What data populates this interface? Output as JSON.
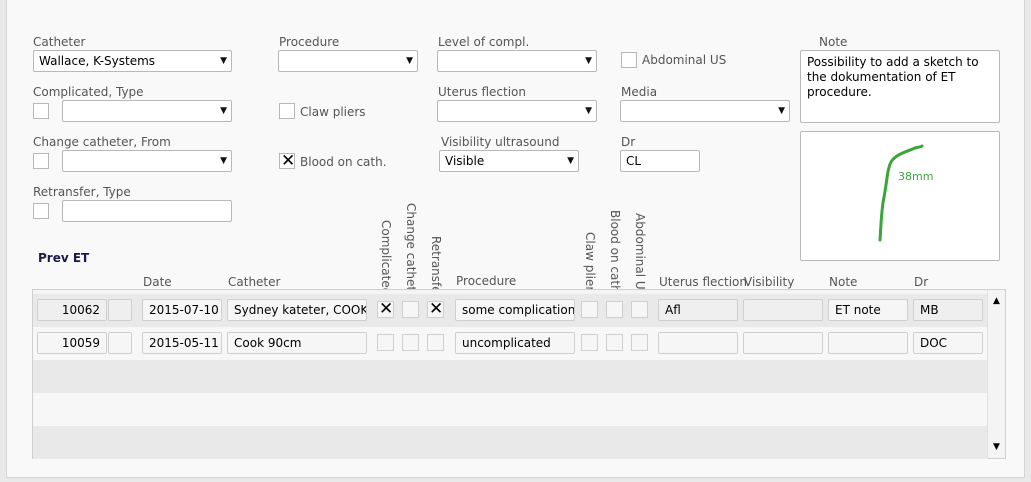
{
  "form": {
    "catheter": {
      "label": "Catheter",
      "value": "Wallace, K-Systems"
    },
    "procedure": {
      "label": "Procedure",
      "value": ""
    },
    "level_of_compl": {
      "label": "Level of compl.",
      "value": ""
    },
    "abdominal_us": {
      "label": "Abdominal US",
      "checked": false
    },
    "complicated": {
      "label": "Complicated, Type",
      "checked": false,
      "value": ""
    },
    "claw_pliers": {
      "label": "Claw pliers",
      "checked": false
    },
    "uterus_flection": {
      "label": "Uterus flection",
      "value": ""
    },
    "media": {
      "label": "Media",
      "value": ""
    },
    "change_catheter": {
      "label": "Change catheter, From",
      "checked": false,
      "value": ""
    },
    "blood_on_cath": {
      "label": "Blood on cath.",
      "checked": true,
      "mark": "✕"
    },
    "visibility_ultrasound": {
      "label": "Visibility ultrasound",
      "value": "Visible"
    },
    "dr": {
      "label": "Dr",
      "value": "CL"
    },
    "retransfer": {
      "label": "Retransfer, Type",
      "checked": false,
      "value": ""
    },
    "note": {
      "label": "Note",
      "value": "Possibility to add a sketch to the dokumentation of ET procedure."
    },
    "sketch": {
      "annotation": "38mm",
      "stroke_color": "#3aa63a"
    }
  },
  "prev_et": {
    "title": "Prev ET",
    "headers": {
      "date": "Date",
      "catheter": "Catheter",
      "complicated": "Complicated",
      "change_catheter": "Change catheter",
      "retransfer": "Retransfer",
      "procedure": "Procedure",
      "claw_pliers": "Claw pliers",
      "blood_on_cath": "Blood on cath.",
      "abdominal_us": "Abdominal US",
      "uterus_flection": "Uterus flection",
      "visibility": "Visibility",
      "note": "Note",
      "dr": "Dr"
    },
    "rows": [
      {
        "id": "10062",
        "date": "2015-07-10",
        "catheter": "Sydney kateter, COOK",
        "complicated": "✕",
        "change_catheter": "",
        "retransfer": "✕",
        "procedure": "some complication",
        "claw_pliers": "",
        "blood_on_cath": "",
        "abdominal_us": "",
        "uterus_flection": "Afl",
        "visibility": "",
        "note": "ET note",
        "dr": "MB"
      },
      {
        "id": "10059",
        "date": "2015-05-11",
        "catheter": "Cook 90cm",
        "complicated": "",
        "change_catheter": "",
        "retransfer": "",
        "procedure": "uncomplicated",
        "claw_pliers": "",
        "blood_on_cath": "",
        "abdominal_us": "",
        "uterus_flection": "",
        "visibility": "",
        "note": "",
        "dr": "DOC"
      }
    ]
  },
  "icons": {
    "dropdown": "▼",
    "scroll_up": "▲",
    "scroll_down": "▼"
  }
}
